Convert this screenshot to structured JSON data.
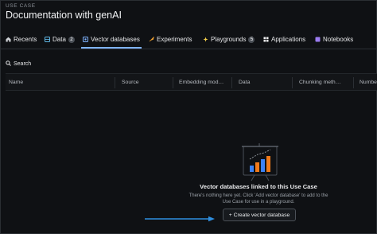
{
  "header": {
    "usecase_label": "USE CASE",
    "title": "Documentation with genAI"
  },
  "tabs": [
    {
      "label": "Recents",
      "icon": "home-icon"
    },
    {
      "label": "Data",
      "badge": "2",
      "icon": "database-icon"
    },
    {
      "label": "Vector databases",
      "icon": "vector-db-icon",
      "active": true
    },
    {
      "label": "Experiments",
      "icon": "rocket-icon"
    },
    {
      "label": "Playgrounds",
      "badge": "5",
      "icon": "playground-icon"
    },
    {
      "label": "Applications",
      "icon": "applications-icon"
    },
    {
      "label": "Notebooks",
      "icon": "notebook-icon"
    }
  ],
  "search": {
    "label": "Search"
  },
  "table": {
    "columns": [
      "Name",
      "Source",
      "Embedding mod…",
      "Data",
      "Chunking meth…",
      "Numbe"
    ]
  },
  "empty_state": {
    "title": "Vector databases linked to this Use Case",
    "subtitle": "There's nothing here yet. Click 'Add vector database' to add to the Use Case for use in a playground.",
    "button_label": "+ Create vector database"
  },
  "colors": {
    "accent": "#7fb3ff",
    "background": "#0f1114",
    "bar_orange": "#f07a1a",
    "bar_blue": "#3b82f6"
  }
}
